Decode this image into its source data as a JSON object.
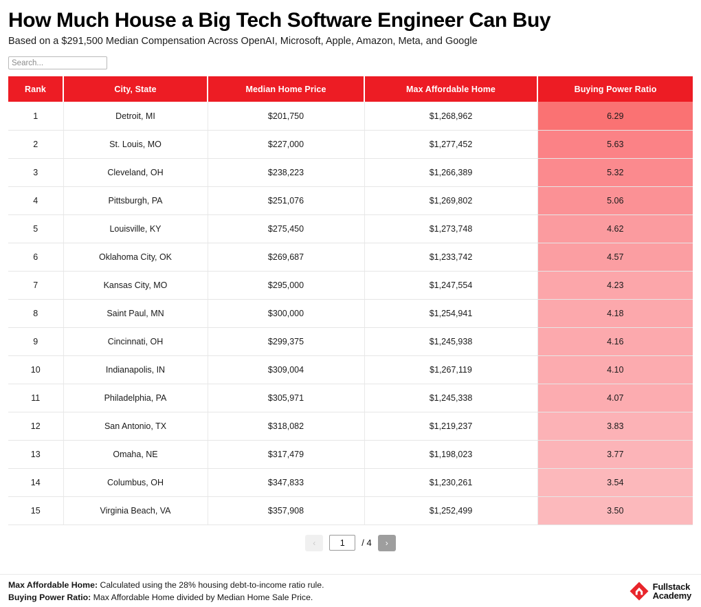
{
  "header": {
    "title": "How Much House a Big Tech Software Engineer Can Buy",
    "subtitle": "Based on a $291,500 Median Compensation Across OpenAI, Microsoft, Apple, Amazon, Meta, and Google"
  },
  "search": {
    "placeholder": "Search...",
    "value": ""
  },
  "table": {
    "columns": [
      "Rank",
      "City, State",
      "Median Home Price",
      "Max Affordable Home",
      "Buying Power Ratio"
    ],
    "rows": [
      {
        "rank": "1",
        "city": "Detroit, MI",
        "median_price": "$201,750",
        "max_affordable": "$1,268,962",
        "ratio": "6.29",
        "ratio_color": "#FA7273"
      },
      {
        "rank": "2",
        "city": "St. Louis, MO",
        "median_price": "$227,000",
        "max_affordable": "$1,277,452",
        "ratio": "5.63",
        "ratio_color": "#FB8286"
      },
      {
        "rank": "3",
        "city": "Cleveland, OH",
        "median_price": "$238,223",
        "max_affordable": "$1,266,389",
        "ratio": "5.32",
        "ratio_color": "#FB8A8E"
      },
      {
        "rank": "4",
        "city": "Pittsburgh, PA",
        "median_price": "$251,076",
        "max_affordable": "$1,269,802",
        "ratio": "5.06",
        "ratio_color": "#FB9195"
      },
      {
        "rank": "5",
        "city": "Louisville, KY",
        "median_price": "$275,450",
        "max_affordable": "$1,273,748",
        "ratio": "4.62",
        "ratio_color": "#FB9B9F"
      },
      {
        "rank": "6",
        "city": "Oklahoma City, OK",
        "median_price": "$269,687",
        "max_affordable": "$1,233,742",
        "ratio": "4.57",
        "ratio_color": "#FB9EA2"
      },
      {
        "rank": "7",
        "city": "Kansas City, MO",
        "median_price": "$295,000",
        "max_affordable": "$1,247,554",
        "ratio": "4.23",
        "ratio_color": "#FCA6AA"
      },
      {
        "rank": "8",
        "city": "Saint Paul, MN",
        "median_price": "$300,000",
        "max_affordable": "$1,254,941",
        "ratio": "4.18",
        "ratio_color": "#FCA8AC"
      },
      {
        "rank": "9",
        "city": "Cincinnati, OH",
        "median_price": "$299,375",
        "max_affordable": "$1,245,938",
        "ratio": "4.16",
        "ratio_color": "#FCA9AD"
      },
      {
        "rank": "10",
        "city": "Indianapolis, IN",
        "median_price": "$309,004",
        "max_affordable": "$1,267,119",
        "ratio": "4.10",
        "ratio_color": "#FCABAF"
      },
      {
        "rank": "11",
        "city": "Philadelphia, PA",
        "median_price": "$305,971",
        "max_affordable": "$1,245,338",
        "ratio": "4.07",
        "ratio_color": "#FCACB0"
      },
      {
        "rank": "12",
        "city": "San Antonio, TX",
        "median_price": "$318,082",
        "max_affordable": "$1,219,237",
        "ratio": "3.83",
        "ratio_color": "#FCB2B6"
      },
      {
        "rank": "13",
        "city": "Omaha, NE",
        "median_price": "$317,479",
        "max_affordable": "$1,198,023",
        "ratio": "3.77",
        "ratio_color": "#FCB4B8"
      },
      {
        "rank": "14",
        "city": "Columbus, OH",
        "median_price": "$347,833",
        "max_affordable": "$1,230,261",
        "ratio": "3.54",
        "ratio_color": "#FCB8BB"
      },
      {
        "rank": "15",
        "city": "Virginia Beach, VA",
        "median_price": "$357,908",
        "max_affordable": "$1,252,499",
        "ratio": "3.50",
        "ratio_color": "#FCB9BC"
      }
    ]
  },
  "pagination": {
    "prev_label": "‹",
    "next_label": "›",
    "current_page": "1",
    "total_label": "/ 4"
  },
  "footer": {
    "note1_label": "Max Affordable Home:",
    "note1_text": " Calculated using the 28% housing debt-to-income ratio rule.",
    "note2_label": "Buying Power Ratio:",
    "note2_text": " Max Affordable Home divided by Median Home Sale Price.",
    "logo_line1": "Fullstack",
    "logo_line2": "Academy",
    "logo_color": "#E8252B"
  },
  "colors": {
    "header_red": "#ED1C24",
    "heat_high": "#FA7273",
    "heat_low": "#FCB9BC"
  }
}
